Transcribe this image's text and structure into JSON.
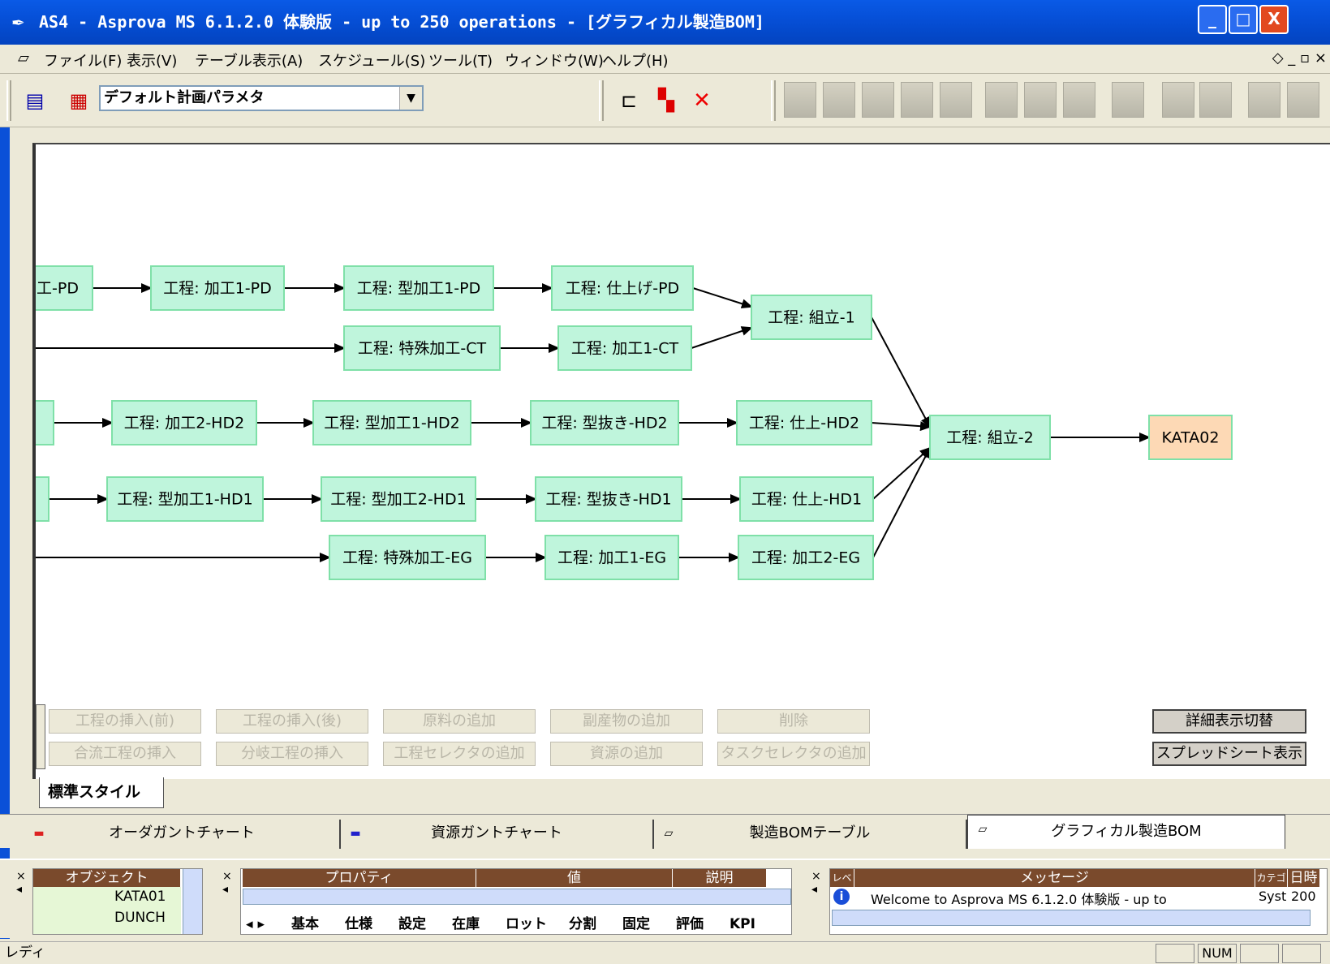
{
  "window": {
    "title": "AS4 - Asprova MS 6.1.2.0 体験版 - up to 250 operations - [グラフィカル製造BOM]",
    "app_icon": "pen-icon",
    "controls": {
      "minimize": "_",
      "maximize": "□",
      "close": "X"
    }
  },
  "menu": {
    "items": [
      "ファイル(F)",
      "表示(V)",
      "テーブル表示(A)",
      "スケジュール(S)",
      "ツール(T)",
      "ウィンドウ(W)",
      "ヘルプ(H)"
    ],
    "mdi_controls": "◇ _ ▫ ×"
  },
  "toolbar": {
    "plan_param_combo": "デフォルト計画パラメタ"
  },
  "bom": {
    "nodes": [
      {
        "id": "n-pd-left",
        "label": "工-PD",
        "kind": "process"
      },
      {
        "id": "n-kako1-pd",
        "label": "工程: 加工1-PD",
        "kind": "process"
      },
      {
        "id": "n-katakako1-pd",
        "label": "工程: 型加工1-PD",
        "kind": "process"
      },
      {
        "id": "n-shiage-pd",
        "label": "工程: 仕上げ-PD",
        "kind": "process"
      },
      {
        "id": "n-tokushu-ct",
        "label": "工程: 特殊加工-CT",
        "kind": "process"
      },
      {
        "id": "n-kako1-ct",
        "label": "工程: 加工1-CT",
        "kind": "process"
      },
      {
        "id": "n-kumitate1",
        "label": "工程: 組立-1",
        "kind": "process"
      },
      {
        "id": "n-kako2-hd2",
        "label": "工程: 加工2-HD2",
        "kind": "process"
      },
      {
        "id": "n-katakako1-hd2",
        "label": "工程: 型加工1-HD2",
        "kind": "process"
      },
      {
        "id": "n-katanuki-hd2",
        "label": "工程: 型抜き-HD2",
        "kind": "process"
      },
      {
        "id": "n-shiage-hd2",
        "label": "工程: 仕上-HD2",
        "kind": "process"
      },
      {
        "id": "n-kumitate2",
        "label": "工程: 組立-2",
        "kind": "process"
      },
      {
        "id": "n-kata02",
        "label": "KATA02",
        "kind": "item"
      },
      {
        "id": "n-katakako1-hd1",
        "label": "工程: 型加工1-HD1",
        "kind": "process"
      },
      {
        "id": "n-katakako2-hd1",
        "label": "工程: 型加工2-HD1",
        "kind": "process"
      },
      {
        "id": "n-katanuki-hd1",
        "label": "工程: 型抜き-HD1",
        "kind": "process"
      },
      {
        "id": "n-shiage-hd1",
        "label": "工程: 仕上-HD1",
        "kind": "process"
      },
      {
        "id": "n-tokushu-eg",
        "label": "工程: 特殊加工-EG",
        "kind": "process"
      },
      {
        "id": "n-kako1-eg",
        "label": "工程: 加工1-EG",
        "kind": "process"
      },
      {
        "id": "n-kako2-eg",
        "label": "工程: 加工2-EG",
        "kind": "process"
      }
    ],
    "colors": {
      "process_fill": "#bff5dc",
      "process_border": "#7fe0a8",
      "item_fill": "#fdd9b5",
      "item_border": "#f4b98a",
      "edge": "#000000"
    }
  },
  "editor": {
    "buttons_row1": [
      "工程の挿入(前)",
      "工程の挿入(後)",
      "原料の追加",
      "副産物の追加",
      "削除"
    ],
    "buttons_row2": [
      "合流工程の挿入",
      "分岐工程の挿入",
      "工程セレクタの追加",
      "資源の追加",
      "タスクセレクタの追加"
    ],
    "detail_toggle": "詳細表示切替",
    "spreadsheet_view": "スプレッドシート表示",
    "style_tab": "標準スタイル"
  },
  "view_tabs": [
    {
      "label": "オーダガントチャート",
      "icon": "gantt-order-icon"
    },
    {
      "label": "資源ガントチャート",
      "icon": "gantt-resource-icon"
    },
    {
      "label": "製造BOMテーブル",
      "icon": "table-doc-icon"
    },
    {
      "label": "グラフィカル製造BOM",
      "icon": "graph-doc-icon",
      "active": true
    }
  ],
  "object_pane": {
    "header": "オブジェクト",
    "rows": [
      "KATA01",
      "DUNCH"
    ]
  },
  "property_pane": {
    "headers": [
      "プロパティ",
      "値",
      "説明"
    ],
    "sheet_tabs": [
      "基本",
      "仕様",
      "設定",
      "在庫",
      "ロット",
      "分割",
      "固定",
      "評価",
      "KPI"
    ]
  },
  "message_pane": {
    "headers": [
      "レベル",
      "メッセージ",
      "カテゴリ",
      "日時"
    ],
    "row": {
      "message": "Welcome to Asprova MS 6.1.2.0 体験版 - up to",
      "category": "Syst",
      "date": "200"
    }
  },
  "status": {
    "ready": "レディ",
    "num": "NUM"
  }
}
